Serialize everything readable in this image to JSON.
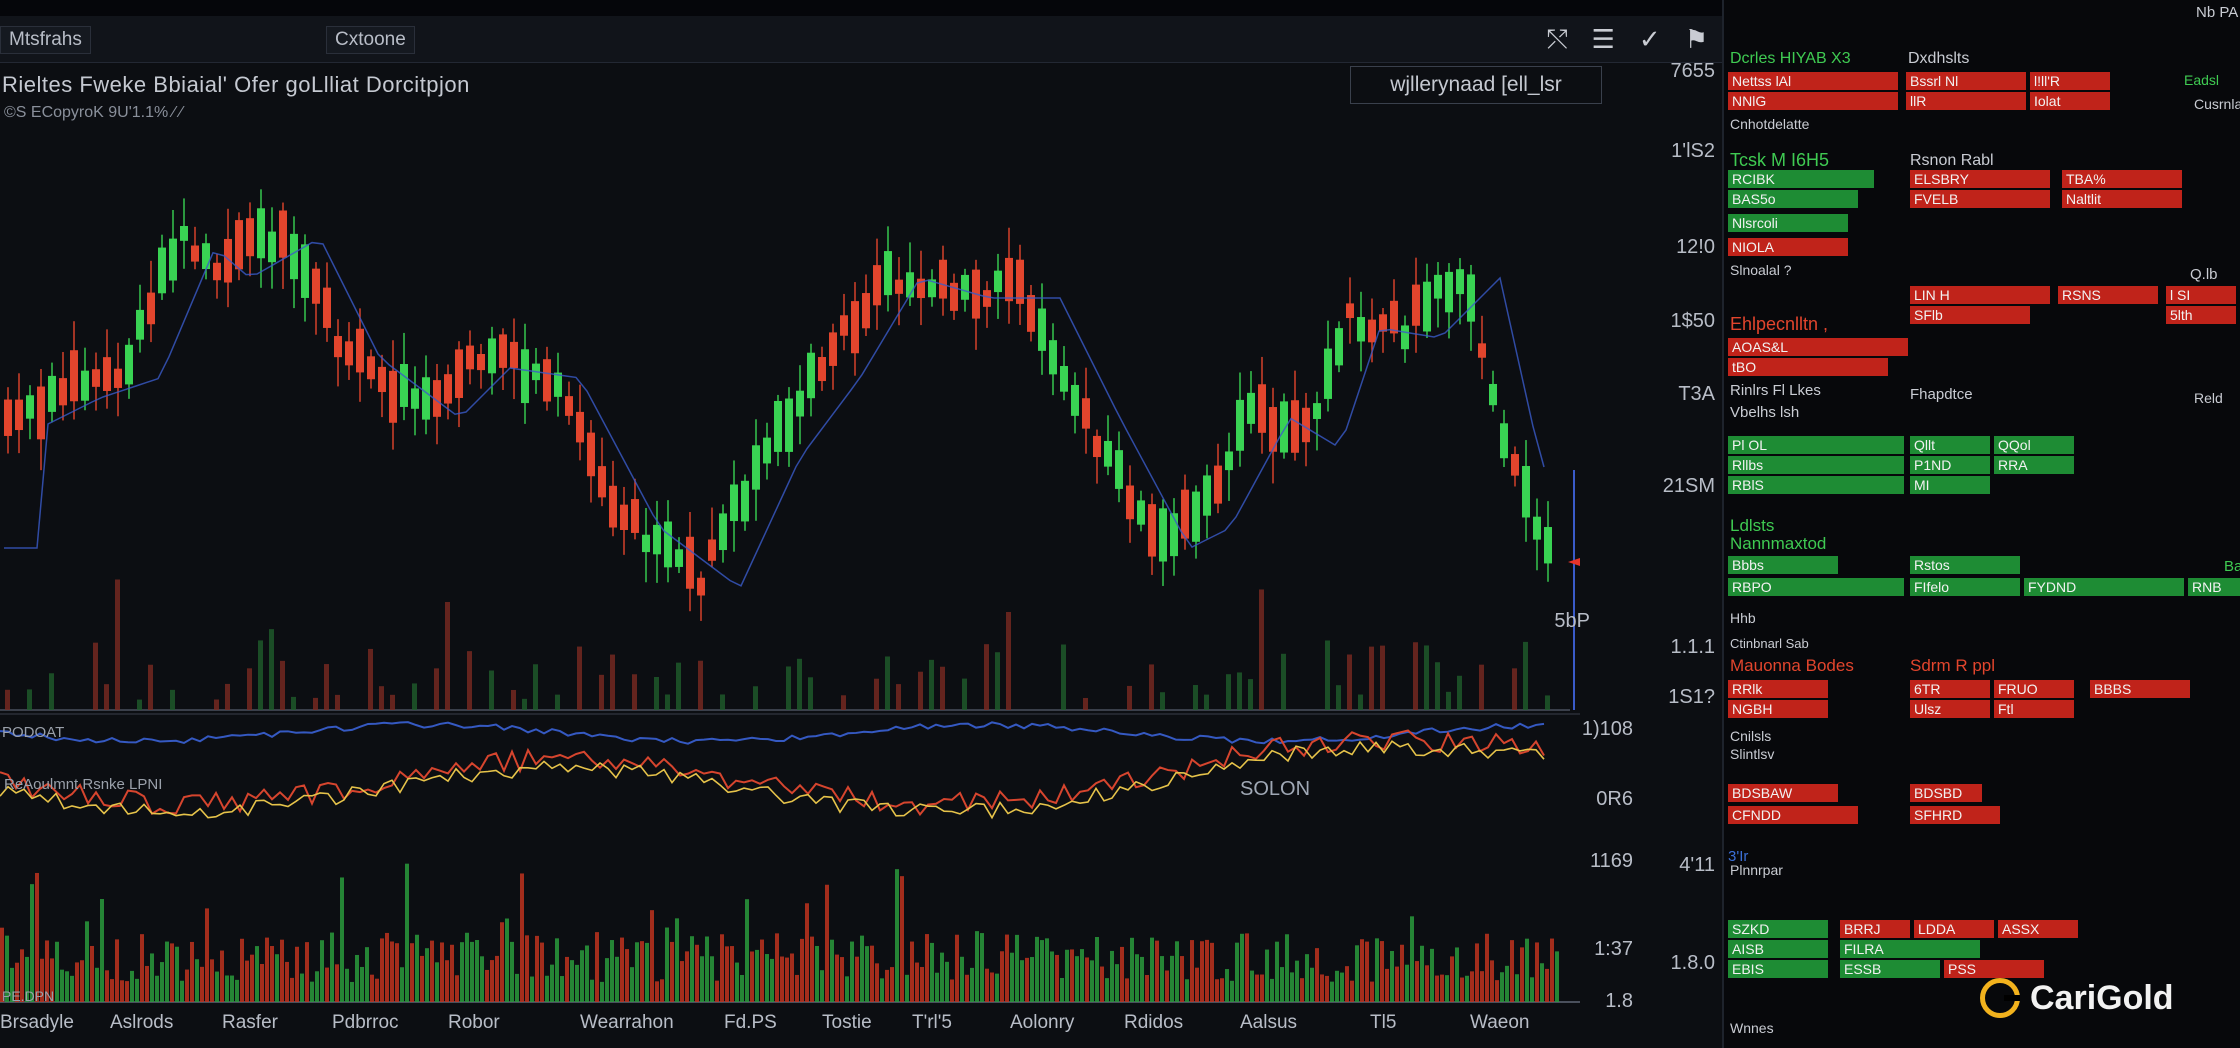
{
  "window": {
    "tab_left": "Mtsfrahs",
    "tab_center": "Cxtoone"
  },
  "chart": {
    "title": "Rieltes Fweke Bbiaial' Ofer goLlliat Dorcitpjon",
    "title_box": "wjllerynaad [ell_lsr",
    "subline": "©S ECopyroK 9U'1.1% ⁄ ⁄"
  },
  "price_axis": [
    "7655",
    "1'lS2",
    "12!0",
    "1$50",
    "T3A",
    "21SM",
    "5bP",
    "1.1.1",
    "1S1?"
  ],
  "osc_axis": [
    "1)108",
    "0R6",
    "1169",
    "4'11",
    "1.8.0"
  ],
  "vol_axis": [
    "1:37",
    "1.8"
  ],
  "x_axis": [
    "Brsadyle",
    "Aslrods",
    "Rasfer",
    "Pdbrroc",
    "Robor",
    "Wearrahon",
    "Fd.PS",
    "Tostie",
    "T'rl'5",
    "Aolonry",
    "Rdidos",
    "Aalsus",
    "Tl5",
    "Waeon"
  ],
  "osc_labels": {
    "top": "PODOAT",
    "mid": "ReAoulmnt Rsnke LPNI",
    "bottom": "PE.DPN",
    "overlay": "SOLON"
  },
  "panel": {
    "header_right": "Nb PA",
    "sections": [
      {
        "label": "Dcrles HIYAB X3",
        "label2": "Dxdhslts"
      },
      {
        "label": "Cnhotdelatte"
      },
      {
        "label": "Tcsk M I6H5",
        "label2": "Rsnon   Rabl"
      },
      {
        "label": "Slnoalal   ?"
      },
      {
        "label": "Ehlpecnlltn ,"
      },
      {
        "label": "Rinlrs Fl Lkes",
        "label2": "Fhapdtce"
      },
      {
        "label": "Vbelhs lsh"
      },
      {
        "label": "Ldlsts",
        "label2": "Nannmaxtod"
      },
      {
        "label": "Hhb"
      },
      {
        "label": "Ctinbnarl Sab"
      },
      {
        "label": "Mauonna Bodes",
        "label2": "Sdrm  R  ppl"
      },
      {
        "label": "Cnilsls",
        "label2": "Slintlsv"
      },
      {
        "label": "Plnnrpar"
      },
      {
        "label": "Wnnes"
      }
    ],
    "right_labels": [
      "Eadsl",
      "Cusrnlal",
      "Q.lb",
      "Reld",
      "Baulnl",
      "3'Ir"
    ]
  },
  "cells": [
    [
      "Nettss  lAl",
      "Bssrl  Nl",
      "l!ll'R"
    ],
    [
      "NNlG",
      "llR",
      "Iolat"
    ],
    [
      "RCIBK",
      "ELSBRY",
      "TBA%"
    ],
    [
      "BAS5o",
      "FVELB",
      "Naltlit"
    ],
    [
      "Nlsrcoli"
    ],
    [
      "NIOLA"
    ],
    [
      "LIN H",
      "RSNS",
      "l SI"
    ],
    [
      "SFlb",
      "5lth"
    ],
    [
      "AOAS&L",
      "tBO"
    ],
    [
      "Pl OL",
      "Qllt",
      "QQol"
    ],
    [
      "Rllbs",
      "P1ND",
      "RRA"
    ],
    [
      "RBlS",
      "MI"
    ],
    [
      "Bbbs",
      "Rstos"
    ],
    [
      "RBPO",
      "FIfelo",
      "FYDND",
      "RNB"
    ],
    [
      "RRlk",
      "6TR",
      "FRUO",
      "BBBS"
    ],
    [
      "NGBH",
      "Ulsz",
      "Ftl"
    ],
    [
      "BDSBAW",
      "BDSBD"
    ],
    [
      "CFNDD",
      "SFHRD"
    ],
    [
      "SZKD",
      "BRRJ",
      "LDDA",
      "ASSX"
    ],
    [
      "AISB",
      "FILRA"
    ],
    [
      "EBIS",
      "ESSB",
      "PSS"
    ]
  ],
  "brand": {
    "name": "CariGold",
    "accent": "#f2b21d"
  },
  "colors": {
    "bull": "#39d353",
    "bear": "#e2452d",
    "ma": "#3a5bc9",
    "osc": "#e6c34a"
  }
}
